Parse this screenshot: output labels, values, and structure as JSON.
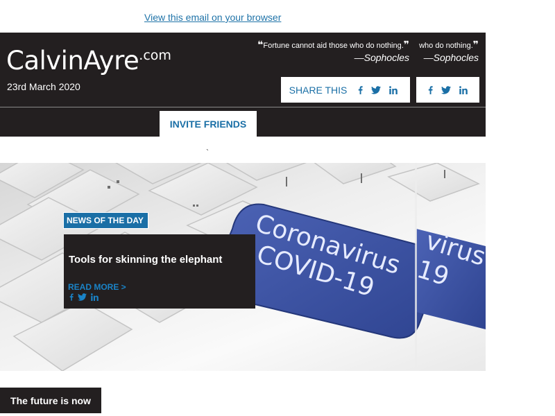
{
  "email": {
    "view_in_browser": "View this email on your browser"
  },
  "header": {
    "logo_main": "CalvinAyre",
    "logo_suffix": ".com",
    "date": "23rd March 2020",
    "quotes": [
      {
        "open_mark": "❝",
        "text": "Fortune cannot aid those who do nothing.",
        "close_mark": "❞",
        "author": "—Sophocles"
      },
      {
        "text": "who do nothing.",
        "close_mark": "❞",
        "author": "—Sophocles"
      }
    ],
    "share_label": "SHARE THIS",
    "social_icons": [
      "facebook-icon",
      "twitter-icon",
      "linkedin-icon"
    ]
  },
  "nav": {
    "invite_label": "INVITE FRIENDS",
    "stray_mark": "`"
  },
  "hero": {
    "key_text_line1": "Coronavirus",
    "key_text_line2": "COVID-19",
    "repeat_line1": "virus",
    "repeat_line2": "19",
    "badge": "NEWS OF THE DAY",
    "title": "Tools for skinning the elephant",
    "read_more": "READ MORE >"
  },
  "section": {
    "future_label": "The future is now"
  },
  "colors": {
    "dark": "#231f20",
    "accent_blue": "#1a6fa6",
    "key_blue": "#3a4fa0"
  }
}
